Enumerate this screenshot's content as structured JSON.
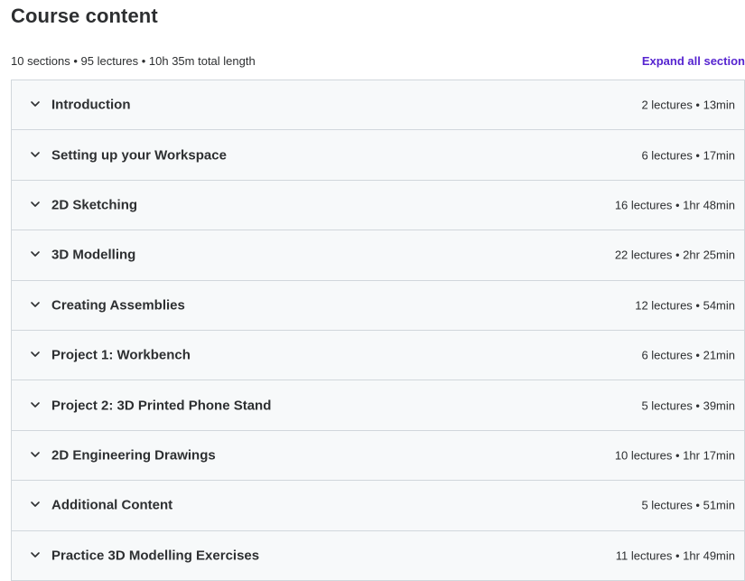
{
  "header": {
    "title": "Course content",
    "summary": "10 sections • 95 lectures • 10h 35m total length",
    "expand_label": "Expand all section"
  },
  "icons": {
    "section_toggle": "chevron-down-icon"
  },
  "colors": {
    "accent": "#5624d0",
    "section_bg": "#f7f9fa",
    "border": "#d1d7dc",
    "text": "#2d2f31"
  },
  "sections": [
    {
      "title": "Introduction",
      "meta": "2 lectures • 13min"
    },
    {
      "title": "Setting up your Workspace",
      "meta": "6 lectures • 17min"
    },
    {
      "title": "2D Sketching",
      "meta": "16 lectures • 1hr 48min"
    },
    {
      "title": "3D Modelling",
      "meta": "22 lectures • 2hr 25min"
    },
    {
      "title": "Creating Assemblies",
      "meta": "12 lectures • 54min"
    },
    {
      "title": "Project 1: Workbench",
      "meta": "6 lectures • 21min"
    },
    {
      "title": "Project 2: 3D Printed Phone Stand",
      "meta": "5 lectures • 39min"
    },
    {
      "title": "2D Engineering Drawings",
      "meta": "10 lectures • 1hr 17min"
    },
    {
      "title": "Additional Content",
      "meta": "5 lectures • 51min"
    },
    {
      "title": "Practice 3D Modelling Exercises",
      "meta": "11 lectures • 1hr 49min"
    }
  ]
}
